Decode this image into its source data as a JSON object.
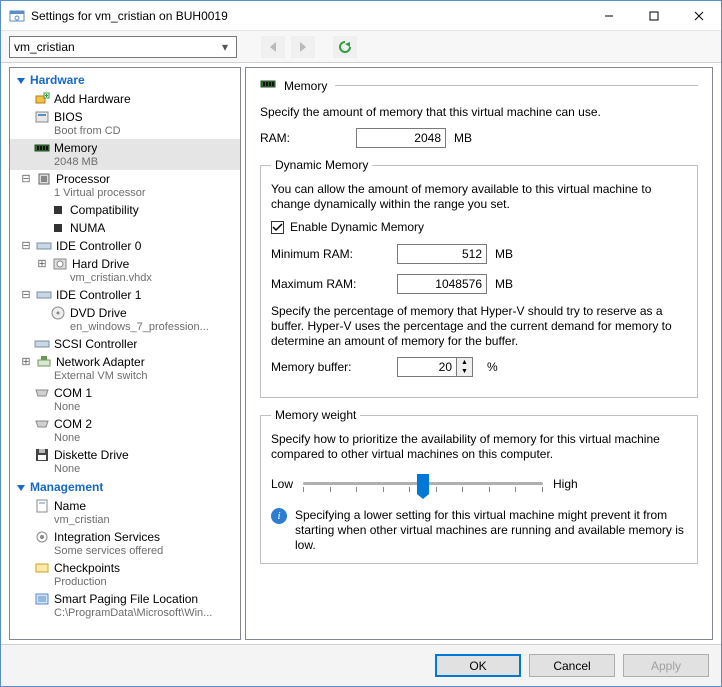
{
  "window": {
    "title": "Settings for vm_cristian on BUH0019"
  },
  "toolbar": {
    "combo_value": "vm_cristian"
  },
  "tree": {
    "hardware_label": "Hardware",
    "management_label": "Management",
    "items": {
      "add_hw": {
        "label": "Add Hardware"
      },
      "bios": {
        "label": "BIOS",
        "sub": "Boot from CD"
      },
      "memory": {
        "label": "Memory",
        "sub": "2048 MB"
      },
      "processor": {
        "label": "Processor",
        "sub": "1 Virtual processor"
      },
      "compat": {
        "label": "Compatibility"
      },
      "numa": {
        "label": "NUMA"
      },
      "ide0": {
        "label": "IDE Controller 0"
      },
      "hd": {
        "label": "Hard Drive",
        "sub": "vm_cristian.vhdx"
      },
      "ide1": {
        "label": "IDE Controller 1"
      },
      "dvd": {
        "label": "DVD Drive",
        "sub": "en_windows_7_profession..."
      },
      "scsi": {
        "label": "SCSI Controller"
      },
      "nic": {
        "label": "Network Adapter",
        "sub": "External VM switch"
      },
      "com1": {
        "label": "COM 1",
        "sub": "None"
      },
      "com2": {
        "label": "COM 2",
        "sub": "None"
      },
      "diskette": {
        "label": "Diskette Drive",
        "sub": "None"
      },
      "name": {
        "label": "Name",
        "sub": "vm_cristian"
      },
      "integ": {
        "label": "Integration Services",
        "sub": "Some services offered"
      },
      "chk": {
        "label": "Checkpoints",
        "sub": "Production"
      },
      "spf": {
        "label": "Smart Paging File Location",
        "sub": "C:\\ProgramData\\Microsoft\\Win..."
      }
    }
  },
  "panel": {
    "title": "Memory",
    "intro": "Specify the amount of memory that this virtual machine can use.",
    "ram_label": "RAM:",
    "ram_value": "2048",
    "mb": "MB",
    "dyn_legend": "Dynamic Memory",
    "dyn_intro": "You can allow the amount of memory available to this virtual machine to change dynamically within the range you set.",
    "enable_label": "Enable Dynamic Memory",
    "min_label": "Minimum RAM:",
    "min_value": "512",
    "max_label": "Maximum RAM:",
    "max_value": "1048576",
    "buffer_intro": "Specify the percentage of memory that Hyper-V should try to reserve as a buffer. Hyper-V uses the percentage and the current demand for memory to determine an amount of memory for the buffer.",
    "buffer_label": "Memory buffer:",
    "buffer_value": "20",
    "percent": "%",
    "weight_legend": "Memory weight",
    "weight_intro": "Specify how to prioritize the availability of memory for this virtual machine compared to other virtual machines on this computer.",
    "low": "Low",
    "high": "High",
    "info": "Specifying a lower setting for this virtual machine might prevent it from starting when other virtual machines are running and available memory is low."
  },
  "buttons": {
    "ok": "OK",
    "cancel": "Cancel",
    "apply": "Apply"
  }
}
